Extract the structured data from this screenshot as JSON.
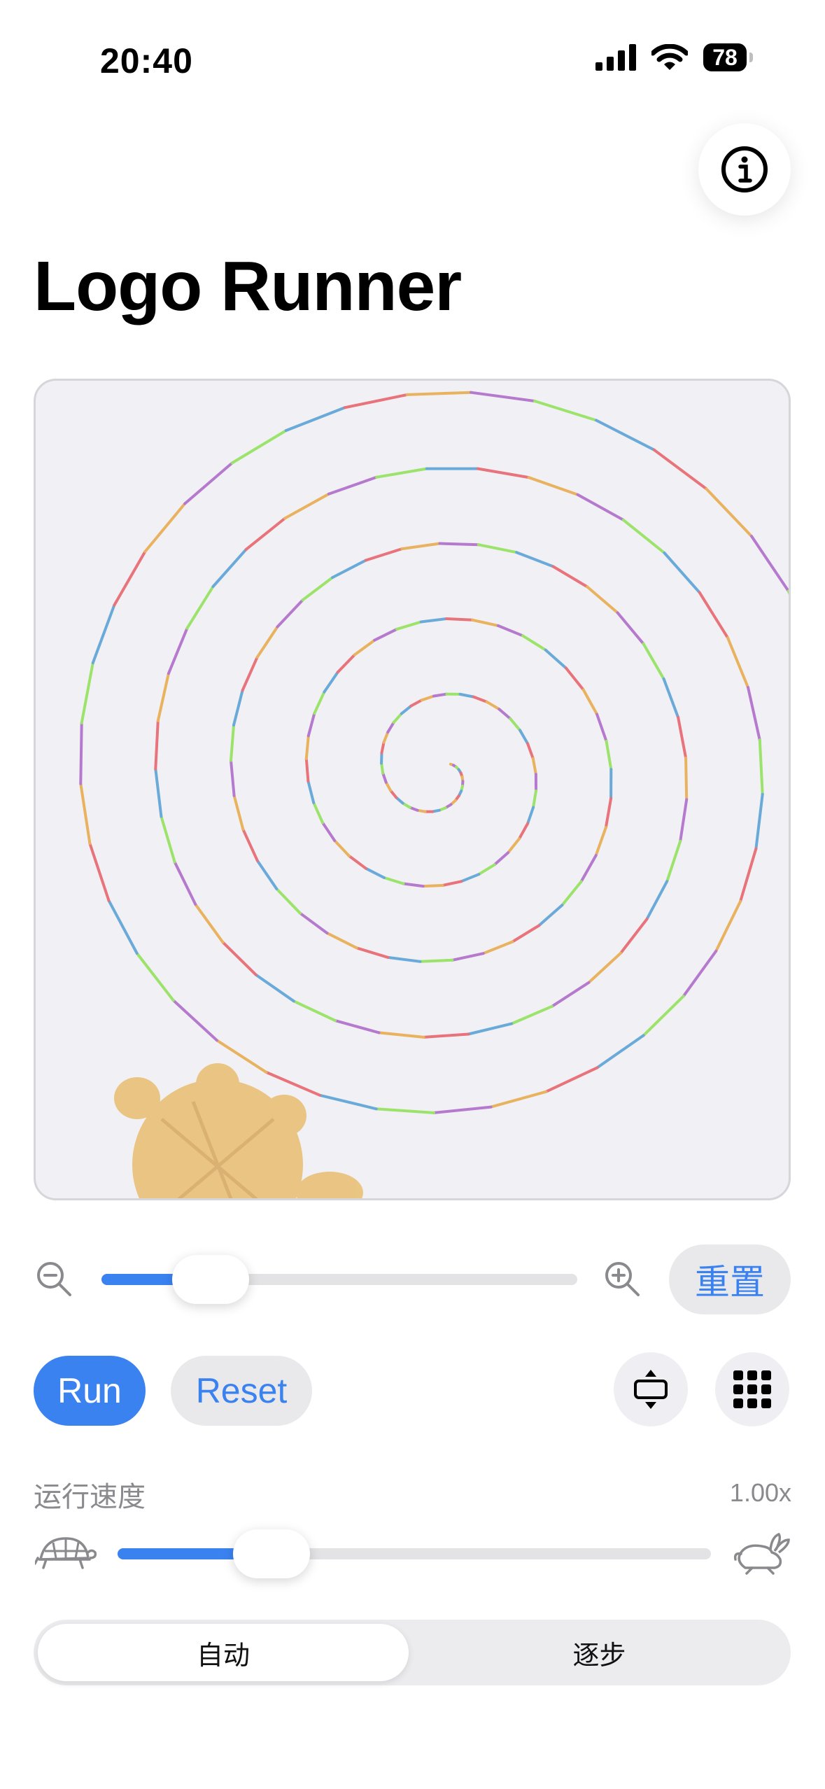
{
  "status": {
    "time": "20:40",
    "battery": "78"
  },
  "header": {
    "title": "Logo Runner"
  },
  "zoom": {
    "value": 0.23,
    "reset_label": "重置"
  },
  "controls": {
    "run_label": "Run",
    "reset_label": "Reset"
  },
  "speed": {
    "label": "运行速度",
    "value_text": "1.00x",
    "value": 0.26
  },
  "mode": {
    "options": [
      "自动",
      "逐步"
    ],
    "selected": "自动"
  },
  "colors": {
    "accent": "#3b82f1",
    "spiral": [
      "#e8737a",
      "#e8b25e",
      "#b57acd",
      "#9be36a",
      "#6aaad9"
    ],
    "turtle": "#e8bf73"
  },
  "icons": [
    "signal-icon",
    "wifi-icon",
    "battery-icon",
    "info-icon",
    "zoom-out-icon",
    "zoom-in-icon",
    "fit-vertical-icon",
    "grid-icon",
    "turtle-icon",
    "rabbit-icon"
  ]
}
